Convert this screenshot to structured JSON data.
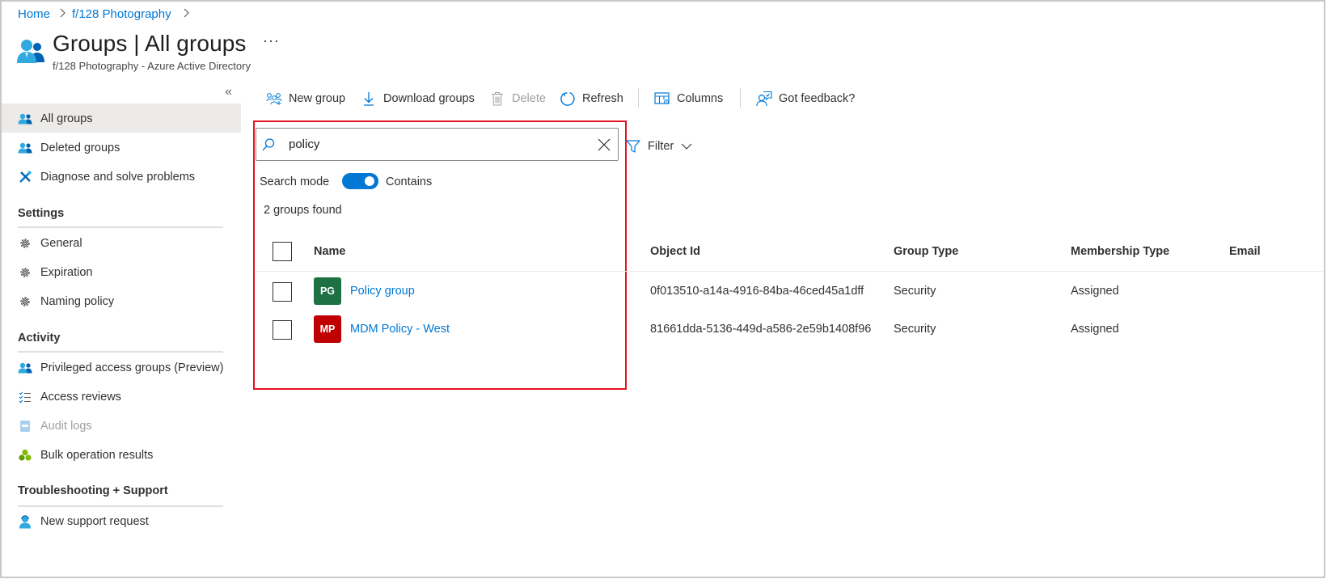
{
  "breadcrumb": [
    {
      "label": "Home"
    },
    {
      "label": "f/128 Photography"
    }
  ],
  "header": {
    "title": "Groups | All groups",
    "more": "···",
    "subtitle": "f/128 Photography - Azure Active Directory"
  },
  "sidebar": {
    "collapse_glyph": "«",
    "top_items": [
      {
        "label": "All groups",
        "icon": "groups-icon",
        "selected": true
      },
      {
        "label": "Deleted groups",
        "icon": "groups-icon"
      },
      {
        "label": "Diagnose and solve problems",
        "icon": "wrench-icon"
      }
    ],
    "sections": [
      {
        "heading": "Settings",
        "items": [
          {
            "label": "General",
            "icon": "gear-icon"
          },
          {
            "label": "Expiration",
            "icon": "gear-icon"
          },
          {
            "label": "Naming policy",
            "icon": "gear-icon"
          }
        ]
      },
      {
        "heading": "Activity",
        "items": [
          {
            "label": "Privileged access groups (Preview)",
            "icon": "groups-icon"
          },
          {
            "label": "Access reviews",
            "icon": "checklist-icon"
          },
          {
            "label": "Audit logs",
            "icon": "log-book-icon",
            "disabled": true
          },
          {
            "label": "Bulk operation results",
            "icon": "cubes-icon"
          }
        ]
      },
      {
        "heading": "Troubleshooting + Support",
        "items": [
          {
            "label": "New support request",
            "icon": "support-agent-icon"
          }
        ]
      }
    ]
  },
  "toolbar": {
    "new_group": "New group",
    "download_groups": "Download groups",
    "delete": "Delete",
    "refresh": "Refresh",
    "columns": "Columns",
    "feedback": "Got feedback?"
  },
  "search": {
    "value": "policy",
    "filter_label": "Filter",
    "mode_label": "Search mode",
    "mode_value": "Contains",
    "mode_on": true,
    "results_count": "2 groups found"
  },
  "table": {
    "columns": [
      "Name",
      "Object Id",
      "Group Type",
      "Membership Type",
      "Email"
    ],
    "rows": [
      {
        "initials": "PG",
        "avatar_color": "#1e7145",
        "name": "Policy group",
        "object_id": "0f013510-a14a-4916-84ba-46ced45a1dff",
        "group_type": "Security",
        "membership_type": "Assigned",
        "email": ""
      },
      {
        "initials": "MP",
        "avatar_color": "#c00000",
        "name": "MDM Policy - West",
        "object_id": "81661dda-5136-449d-a586-2e59b1408f96",
        "group_type": "Security",
        "membership_type": "Assigned",
        "email": ""
      }
    ]
  },
  "colors": {
    "accent": "#0078d4",
    "highlight_box": "#e81123",
    "nav_selected_bg": "#edebe9"
  }
}
